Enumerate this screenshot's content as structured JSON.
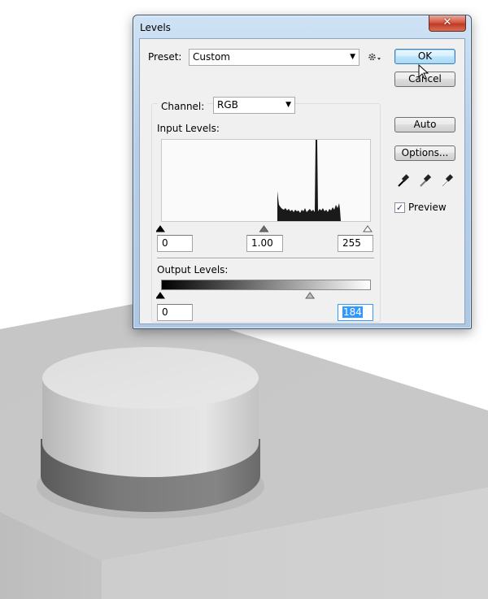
{
  "dialog": {
    "title": "Levels",
    "close_glyph": "✕",
    "preset": {
      "label": "Preset:",
      "value": "Custom",
      "options_icon": "gear-icon"
    },
    "channel": {
      "label": "Channel:",
      "value": "RGB"
    },
    "input_levels": {
      "label": "Input Levels:",
      "black": "0",
      "gamma": "1.00",
      "white": "255",
      "black_fraction": 0,
      "gamma_fraction": 0.5,
      "white_fraction": 1
    },
    "output_levels": {
      "label": "Output Levels:",
      "black": "0",
      "white": "184",
      "black_fraction": 0,
      "white_fraction": 0.722
    },
    "buttons": {
      "ok": "OK",
      "cancel": "Cancel",
      "auto": "Auto",
      "options": "Options..."
    },
    "eyedroppers": [
      "black-eyedropper-icon",
      "gray-eyedropper-icon",
      "white-eyedropper-icon"
    ],
    "preview": {
      "label": "Preview",
      "checked": true
    }
  },
  "colors": {
    "title_gradient": "#bcd3ec",
    "close_button": "#c9452f",
    "client_bg": "#f0f0f0",
    "selection": "#3399ff"
  }
}
